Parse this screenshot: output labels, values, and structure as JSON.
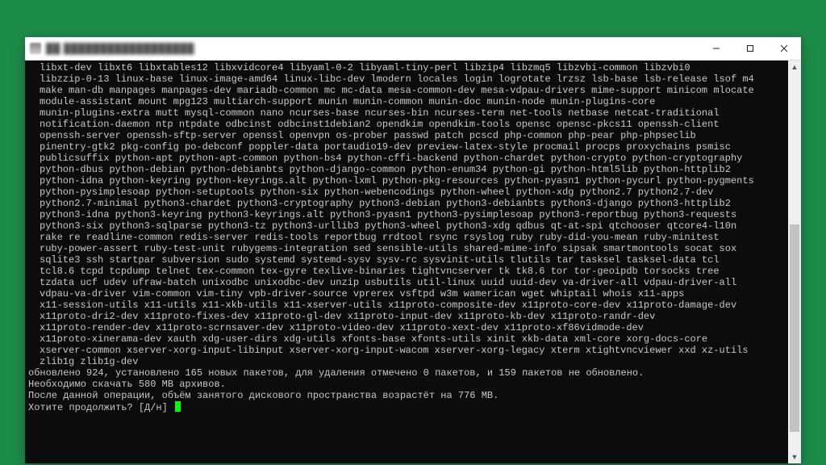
{
  "window": {
    "title_blurred": "██ ██████████████████"
  },
  "package_lines": [
    "libxt-dev libxt6 libxtables12 libxvidcore4 libyaml-0-2 libyaml-tiny-perl libzip4 libzmq5 libzvbi-common libzvbi0",
    "libzzip-0-13 linux-base linux-image-amd64 linux-libc-dev lmodern locales login logrotate lrzsz lsb-base lsb-release lsof m4",
    "make man-db manpages manpages-dev mariadb-common mc mc-data mesa-common-dev mesa-vdpau-drivers mime-support minicom mlocate",
    "module-assistant mount mpg123 multiarch-support munin munin-common munin-doc munin-node munin-plugins-core",
    "munin-plugins-extra mutt mysql-common nano ncurses-base ncurses-bin ncurses-term net-tools netbase netcat-traditional",
    "notification-daemon ntp ntpdate odbcinst odbcinst1debian2 opendkim opendkim-tools opensc opensc-pkcs11 openssh-client",
    "openssh-server openssh-sftp-server openssl openvpn os-prober passwd patch pcscd php-common php-pear php-phpseclib",
    "pinentry-gtk2 pkg-config po-debconf poppler-data portaudio19-dev preview-latex-style procmail procps proxychains psmisc",
    "publicsuffix python-apt python-apt-common python-bs4 python-cffi-backend python-chardet python-crypto python-cryptography",
    "python-dbus python-debian python-debianbts python-django-common python-enum34 python-gi python-html5lib python-httplib2",
    "python-idna python-keyring python-keyrings.alt python-lxml python-pkg-resources python-pyasn1 python-pycurl python-pygments",
    "python-pysimplesoap python-setuptools python-six python-webencodings python-wheel python-xdg python2.7 python2.7-dev",
    "python2.7-minimal python3-chardet python3-cryptography python3-debian python3-debianbts python3-django python3-httplib2",
    "python3-idna python3-keyring python3-keyrings.alt python3-pyasn1 python3-pysimplesoap python3-reportbug python3-requests",
    "python3-six python3-sqlparse python3-tz python3-urllib3 python3-wheel python3-xdg qdbus qt-at-spi qtchooser qtcore4-l10n",
    "rake re readline-common redis-server redis-tools reportbug rrdtool rsync rsyslog ruby ruby-did-you-mean ruby-minitest",
    "ruby-power-assert ruby-test-unit rubygems-integration sed sensible-utils shared-mime-info sipsak smartmontools socat sox",
    "sqlite3 ssh startpar subversion sudo systemd systemd-sysv sysv-rc sysvinit-utils tlutils tar tasksel tasksel-data tcl",
    "tcl8.6 tcpd tcpdump telnet tex-common tex-gyre texlive-binaries tightvncserver tk tk8.6 tor tor-geoipdb torsocks tree",
    "tzdata ucf udev ufraw-batch unixodbc unixodbc-dev unzip usbutils util-linux uuid uuid-dev va-driver-all vdpau-driver-all",
    "vdpau-va-driver vim-common vim-tiny vpb-driver-source vprerex vsftpd w3m wamerican wget whiptail whois x11-apps",
    "x11-session-utils x11-utils x11-xkb-utils x11-xserver-utils x11proto-composite-dev x11proto-core-dev x11proto-damage-dev",
    "x11proto-dri2-dev x11proto-fixes-dev x11proto-gl-dev x11proto-input-dev x11proto-kb-dev x11proto-randr-dev",
    "x11proto-render-dev x11proto-scrnsaver-dev x11proto-video-dev x11proto-xext-dev x11proto-xf86vidmode-dev",
    "x11proto-xinerama-dev xauth xdg-user-dirs xdg-utils xfonts-base xfonts-utils xinit xkb-data xml-core xorg-docs-core",
    "xserver-common xserver-xorg-input-libinput xserver-xorg-input-wacom xserver-xorg-legacy xterm xtightvncviewer xxd xz-utils",
    "zlib1g zlib1g-dev"
  ],
  "summary": {
    "line1": "обновлено 924, установлено 165 новых пакетов, для удаления отмечено 0 пакетов, и 159 пакетов не обновлено.",
    "line2": "Необходимо скачать 580 MB архивов.",
    "line3": "После данной операции, объём занятого дискового пространства возрастёт на 776 MB.",
    "prompt": "Хотите продолжить? [Д/н] "
  }
}
